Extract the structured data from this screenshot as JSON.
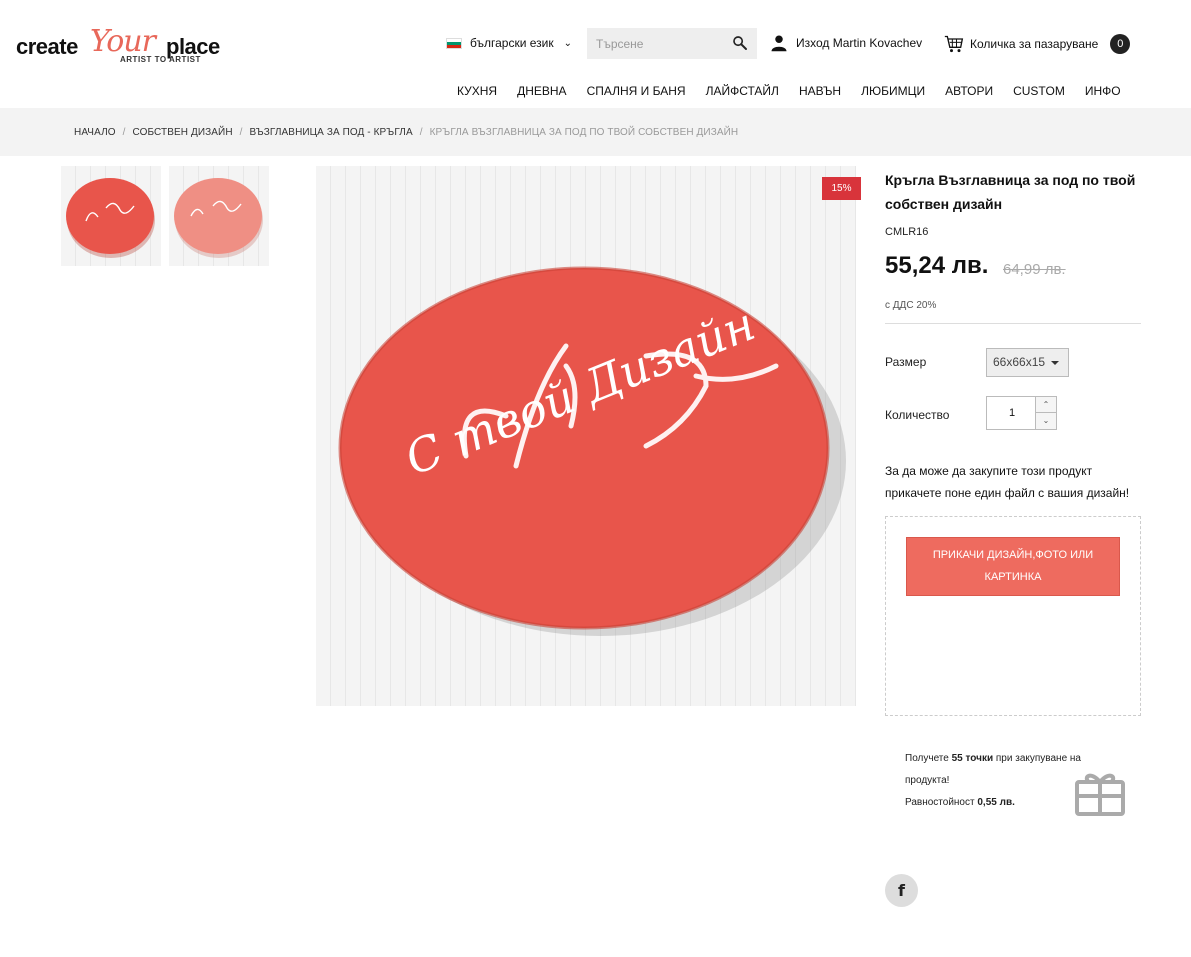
{
  "logo": {
    "word1": "create",
    "word2": "Your",
    "word3": "place",
    "tagline": "ARTIST TO ARTIST"
  },
  "header": {
    "language": "български език",
    "search_placeholder": "Търсене",
    "account_label": "Изход Martin Kovachev",
    "cart_label": "Количка за пазаруване",
    "cart_count": "0"
  },
  "nav": {
    "items": [
      "КУХНЯ",
      "ДНЕВНА",
      "СПАЛНЯ И БАНЯ",
      "ЛАЙФСТАЙЛ",
      "НАВЪН",
      "ЛЮБИМЦИ",
      "АВТОРИ",
      "CUSTOM",
      "ИНФО"
    ]
  },
  "breadcrumb": {
    "items": [
      "НАЧАЛО",
      "СОБСТВЕН ДИЗАЙН",
      "ВЪЗГЛАВНИЦА ЗА ПОД - КРЪГЛА"
    ],
    "current": "КРЪГЛА ВЪЗГЛАВНИЦА ЗА ПОД ПО ТВОЙ СОБСТВЕН ДИЗАЙН"
  },
  "product": {
    "discount_badge": "15%",
    "title": "Кръгла Възглавница за под по твой собствен дизайн",
    "sku": "CMLR16",
    "price": "55,24 лв.",
    "old_price": "64,99 лв.",
    "vat_note": "с ДДС 20%",
    "size_label": "Размер",
    "size_value": "66x66x15",
    "qty_label": "Количество",
    "qty_value": "1",
    "upload_note": "За да може да закупите този продукт прикачете поне един файл с вашия дизайн!",
    "upload_button": "ПРИКАЧИ ДИЗАЙН,ФОТО ИЛИ КАРТИНКА",
    "points_prefix": "Получете",
    "points_value": "55 точки",
    "points_suffix": "при закупуване на продукта!",
    "points_equiv_label": "Равностойност",
    "points_equiv_value": "0,55 лв.",
    "pillow_text": "С твой Дизайн"
  },
  "colors": {
    "accent": "#ee6b5f",
    "badge": "#d8343b",
    "pillow": "#e8554b"
  }
}
